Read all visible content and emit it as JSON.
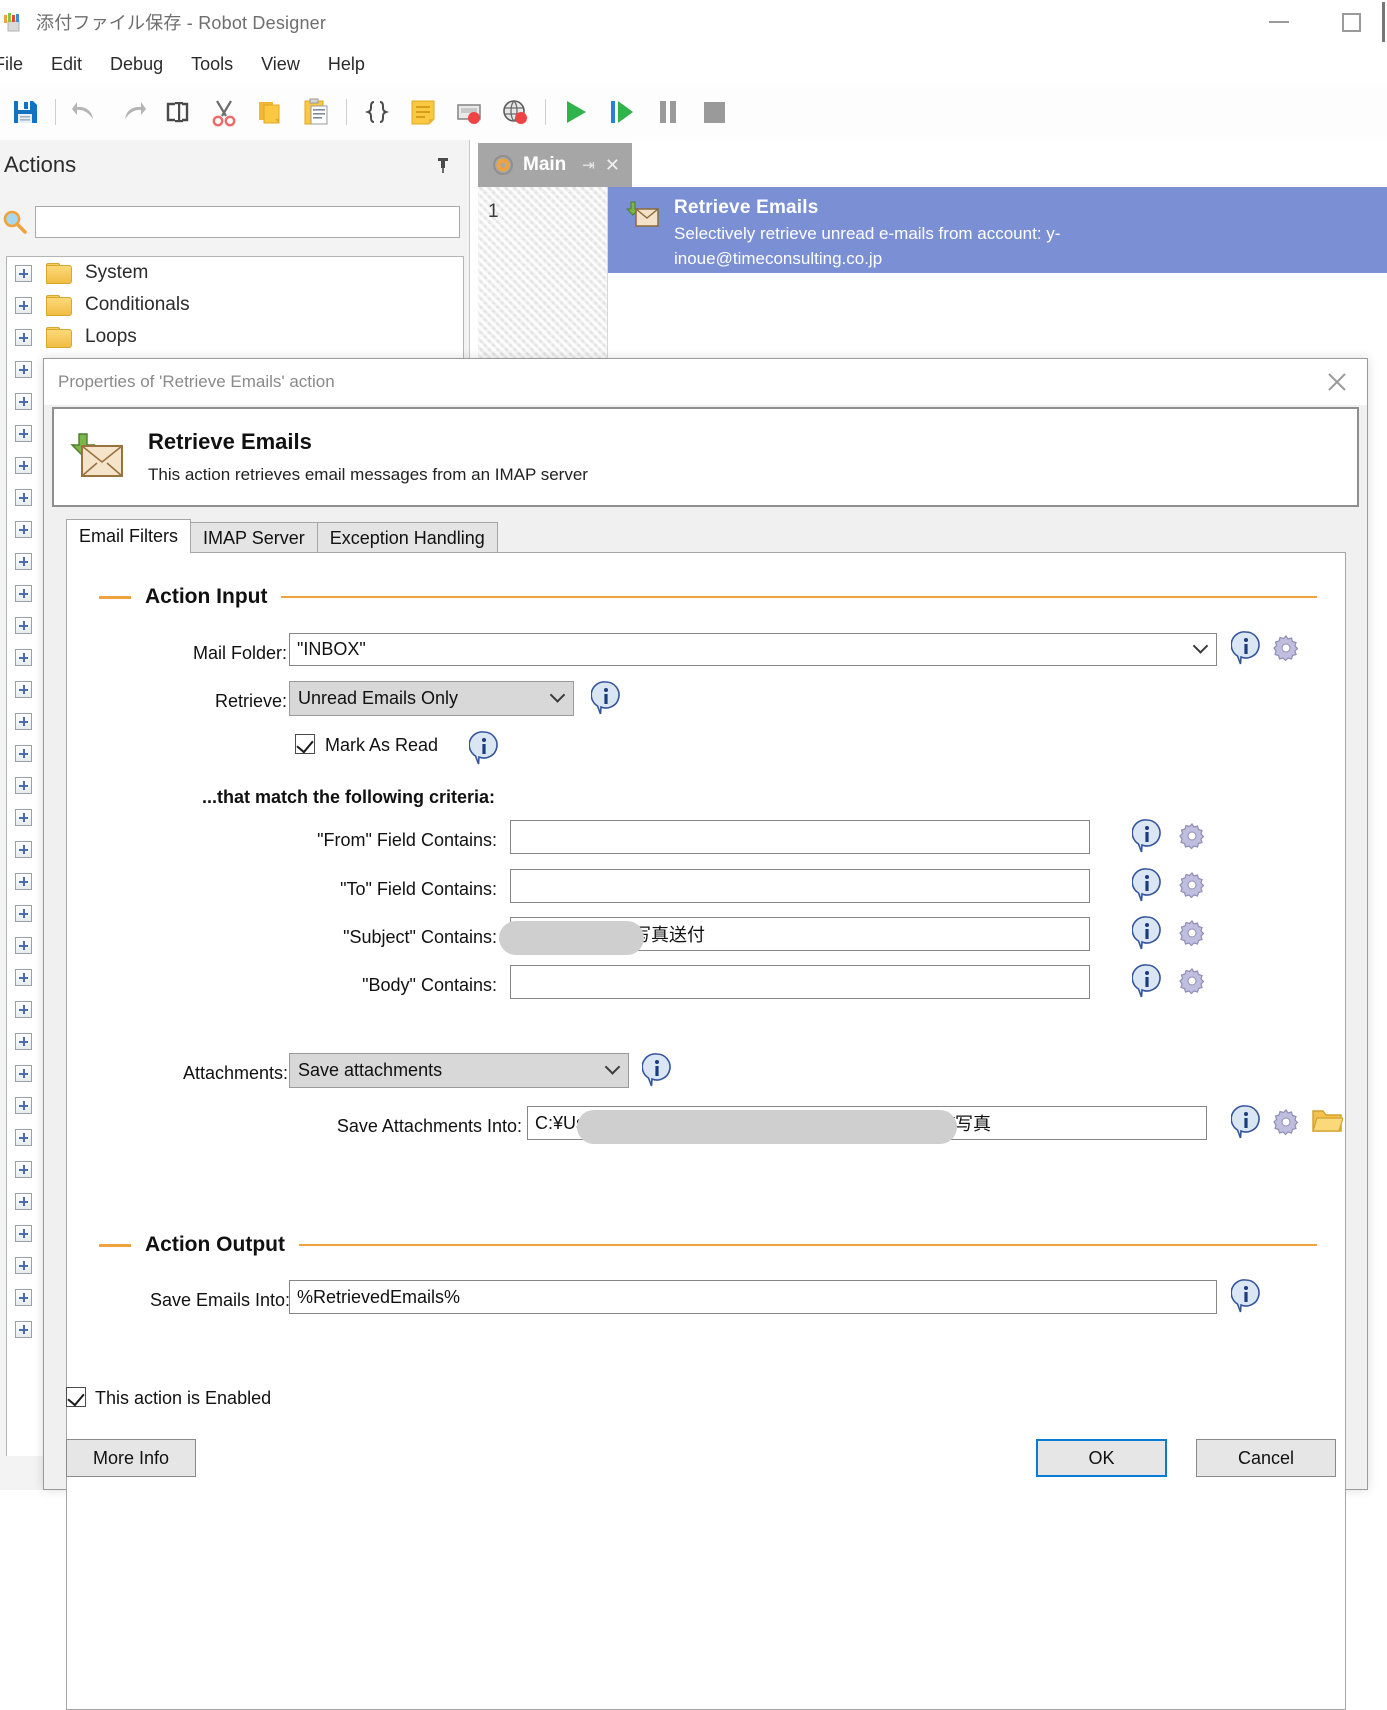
{
  "window": {
    "title": "添付ファイル保存 - Robot Designer",
    "app_icon": "robot-icon",
    "minimize_label": "—",
    "maximize_label": "□"
  },
  "menubar": {
    "items": [
      {
        "label": "File"
      },
      {
        "label": "Edit"
      },
      {
        "label": "Debug"
      },
      {
        "label": "Tools"
      },
      {
        "label": "View"
      },
      {
        "label": "Help"
      }
    ]
  },
  "toolbar": {
    "buttons": [
      {
        "name": "save-icon"
      },
      {
        "name": "undo-icon"
      },
      {
        "name": "redo-icon"
      },
      {
        "name": "rename-icon"
      },
      {
        "name": "cut-icon"
      },
      {
        "name": "copy-icon"
      },
      {
        "name": "paste-icon"
      },
      {
        "name": "braces-icon"
      },
      {
        "name": "notes-icon"
      },
      {
        "name": "screen-recorder-icon"
      },
      {
        "name": "web-recorder-icon"
      },
      {
        "name": "run-icon"
      },
      {
        "name": "step-icon"
      },
      {
        "name": "pause-icon"
      },
      {
        "name": "stop-icon"
      }
    ]
  },
  "actions_panel": {
    "title": "Actions",
    "search_placeholder": "",
    "search_value": "",
    "tree_items": [
      {
        "label": "System"
      },
      {
        "label": "Conditionals"
      },
      {
        "label": "Loops"
      }
    ],
    "hidden_row_count": 31
  },
  "workflow": {
    "tab": {
      "label": "Main",
      "pin": "⇥",
      "close": "✕"
    },
    "line_number": "1",
    "step": {
      "title": "Retrieve Emails",
      "description": "Selectively retrieve unread e-mails from account: y-inoue@timeconsulting.co.jp"
    }
  },
  "dialog": {
    "title": "Properties of 'Retrieve Emails' action",
    "close_label": "✕",
    "banner": {
      "title": "Retrieve Emails",
      "subtitle": "This action retrieves email messages from an IMAP server"
    },
    "tabs": [
      {
        "label": "Email Filters",
        "active": true
      },
      {
        "label": "IMAP Server",
        "active": false
      },
      {
        "label": "Exception Handling",
        "active": false
      }
    ],
    "action_input": {
      "heading": "Action Input",
      "mail_folder": {
        "label": "Mail Folder:",
        "value": "\"INBOX\""
      },
      "retrieve": {
        "label": "Retrieve:",
        "value": "Unread Emails Only"
      },
      "mark_as_read": {
        "label": "Mark As Read",
        "checked": true
      },
      "criteria_heading": "...that match the following criteria:",
      "criteria": [
        {
          "label": "\"From\" Field Contains:",
          "value": "",
          "redacted": false
        },
        {
          "label": "\"To\" Field Contains:",
          "value": "",
          "redacted": false
        },
        {
          "label": "\"Subject\" Contains:",
          "value": "写真送付",
          "redacted": true
        },
        {
          "label": "\"Body\" Contains:",
          "value": "",
          "redacted": false
        }
      ],
      "attachments": {
        "label": "Attachments:",
        "value": "Save attachments"
      },
      "save_into": {
        "label": "Save Attachments Into:",
        "value_prefix": "C:¥Use",
        "value_suffix": "¥写真",
        "redacted": true
      }
    },
    "action_output": {
      "heading": "Action Output",
      "save_emails_into": {
        "label": "Save Emails Into:",
        "value": "%RetrievedEmails%"
      }
    },
    "footer": {
      "enabled_checkbox": {
        "label": "This action is Enabled",
        "checked": true
      },
      "more_info": "More Info",
      "ok": "OK",
      "cancel": "Cancel"
    }
  },
  "colors": {
    "accent_orange": "#f0a33c",
    "step_highlight": "#7b8fd4",
    "primary_button_border": "#0a7bd6"
  }
}
